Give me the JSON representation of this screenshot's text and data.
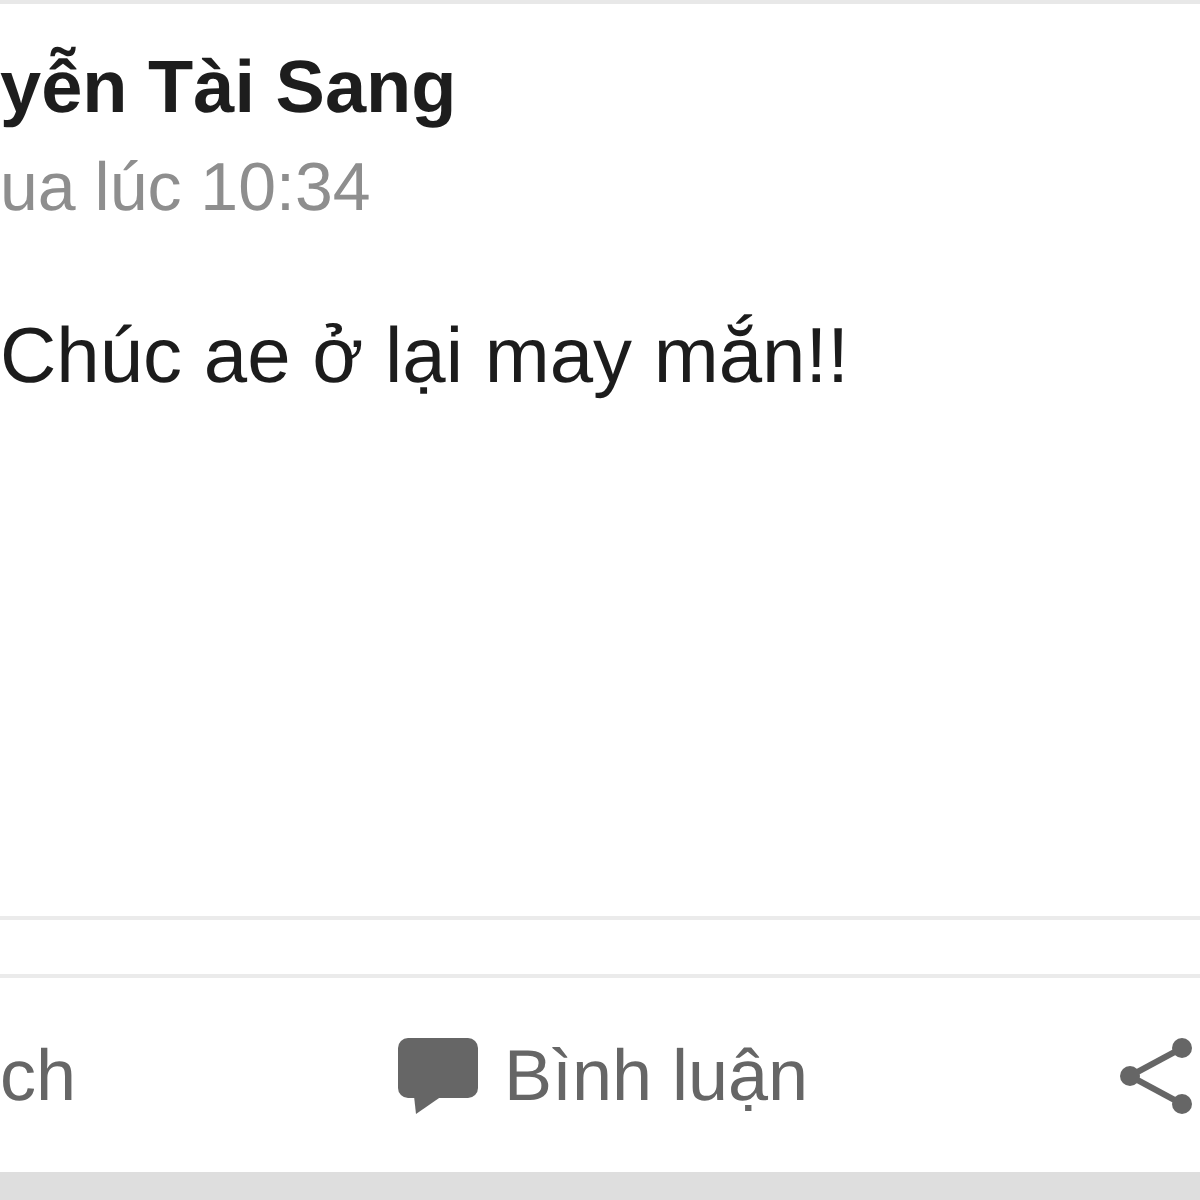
{
  "post": {
    "author": "yễn Tài Sang",
    "timestamp": "ua lúc 10:34",
    "text": "Chúc ae ở lại may mắn!!"
  },
  "actions": [
    {
      "kind": "text",
      "label": "ch"
    },
    {
      "kind": "comment",
      "label": "Bình luận"
    },
    {
      "kind": "share"
    }
  ]
}
